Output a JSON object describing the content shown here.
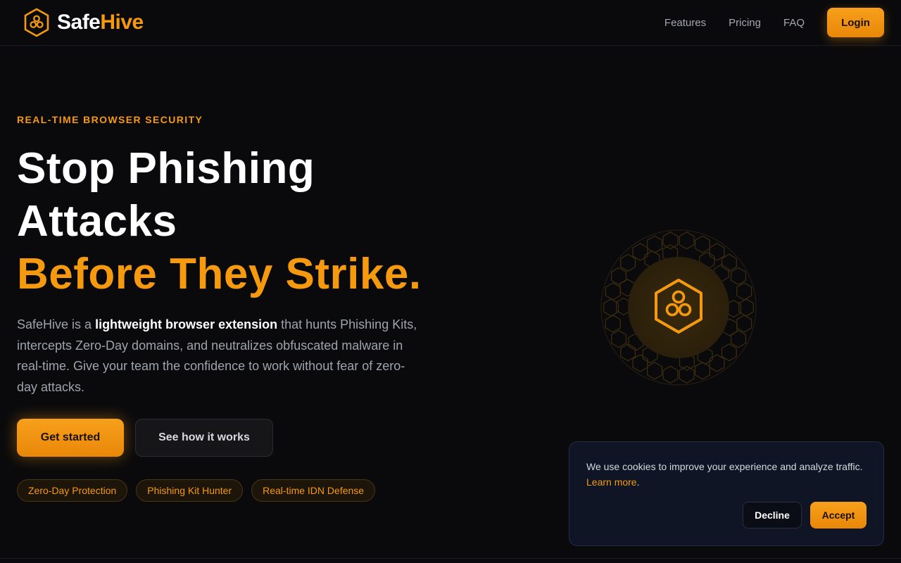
{
  "brand": {
    "name_part1": "Safe",
    "name_part2": "Hive",
    "icon": "hive-logo-icon"
  },
  "nav": {
    "links": [
      {
        "label": "Features"
      },
      {
        "label": "Pricing"
      },
      {
        "label": "FAQ"
      }
    ],
    "login_label": "Login"
  },
  "hero": {
    "eyebrow": "REAL-TIME BROWSER SECURITY",
    "headline_line1": "Stop Phishing",
    "headline_line2": "Attacks",
    "headline_accent": "Before They Strike.",
    "lead_prefix": "SafeHive is a ",
    "lead_bold": "lightweight browser extension",
    "lead_suffix": " that hunts Phishing Kits, intercepts Zero-Day domains, and neutralizes obfuscated malware in real-time. Give your team the confidence to work without fear of zero-day attacks.",
    "primary_cta": "Get started",
    "secondary_cta": "See how it works",
    "tags": [
      "Zero-Day Protection",
      "Phishing Kit Hunter",
      "Real-time IDN Defense"
    ],
    "graphic_icon": "hive-shield-icon"
  },
  "cookie": {
    "text": "We use cookies to improve your experience and analyze traffic. ",
    "link_label": "Learn more",
    "link_suffix": ".",
    "decline_label": "Decline",
    "accept_label": "Accept"
  },
  "colors": {
    "accent": "#f59a0f",
    "background": "#0a0a0c",
    "cookie_bg": "#0f1524",
    "muted_text": "#9ea3ad"
  }
}
